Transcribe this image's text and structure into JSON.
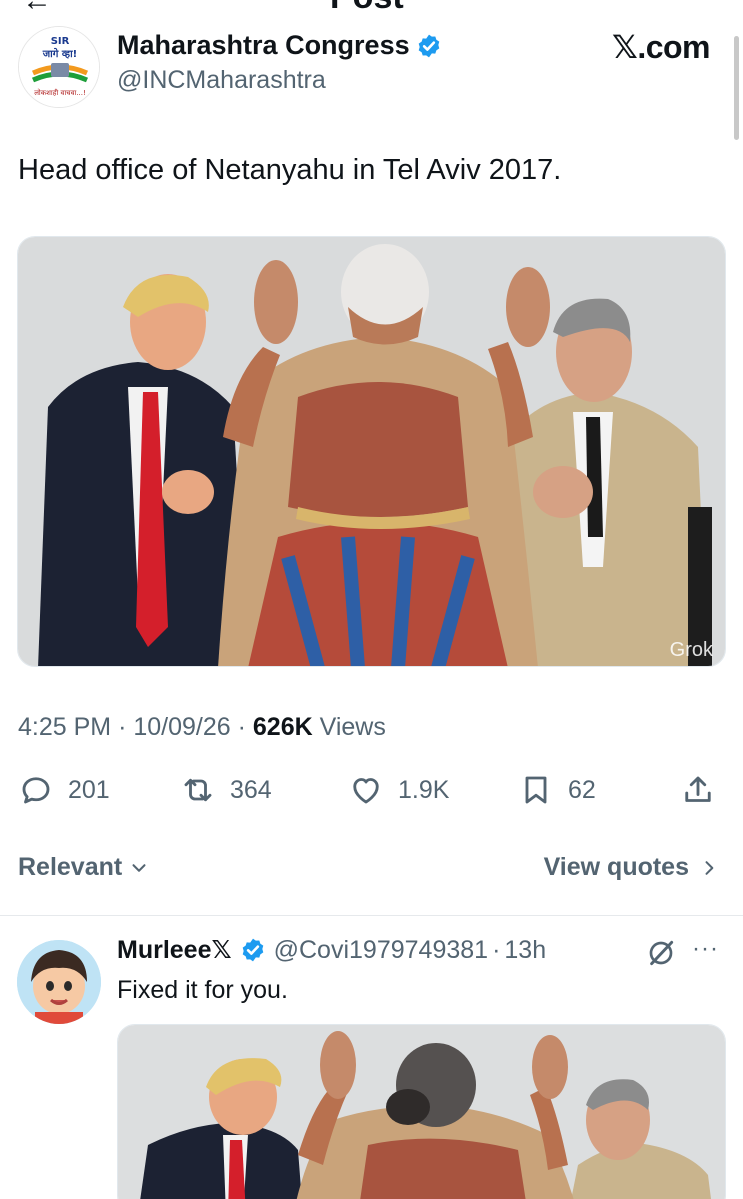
{
  "top_bar": {
    "title": "Post",
    "back_icon": "arrow-left-icon"
  },
  "tweet": {
    "author": {
      "display_name": "Maharashtra Congress",
      "handle": "@INCMaharashtra",
      "verified": true,
      "avatar_text_top": "SIR",
      "avatar_text_mid": "जागे व्हा!",
      "avatar_text_bottom": "लोकशाही वाचवा...!"
    },
    "source_label": "𝕏.com",
    "text": "Head office of Netanyahu in Tel Aviv 2017.",
    "media_watermark": "Grok",
    "time": "4:25 PM",
    "date": "10/09/26",
    "views_count": "626K",
    "views_label": "Views",
    "separator": "·",
    "stats": {
      "replies": "201",
      "reposts": "364",
      "likes": "1.9K",
      "bookmarks": "62"
    },
    "colors": {
      "verified": "#1d9bf0",
      "secondary_text": "#536471",
      "text": "#0f1419"
    }
  },
  "filters": {
    "sort_label": "Relevant",
    "quotes_label": "View quotes"
  },
  "reply": {
    "display_name": "Murleee𝕏",
    "verified": true,
    "handle": "@Covi1979749381",
    "time": "13h",
    "separator": "·",
    "text": "Fixed it for you.",
    "more_label": "···"
  }
}
